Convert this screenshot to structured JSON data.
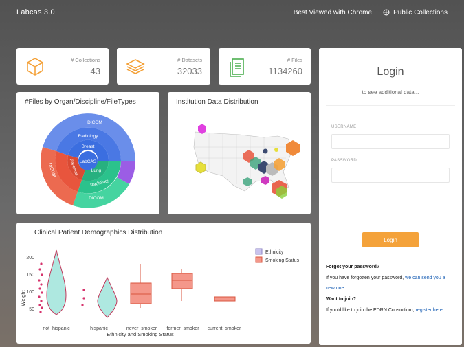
{
  "app": {
    "title": "Labcas 3.0",
    "browser_note": "Best Viewed with Chrome",
    "public_link": "Public Collections"
  },
  "stats": [
    {
      "label": "# Collections",
      "value": "43"
    },
    {
      "label": "# Datasets",
      "value": "32033"
    },
    {
      "label": "# Files",
      "value": "1134260"
    }
  ],
  "sunburst": {
    "title": "#Files by Organ/Discipline/FileTypes",
    "center": "LabCAS",
    "labels": {
      "breast": "Breast",
      "radiology": "Radiology",
      "dicom": "DICOM",
      "lung": "Lung",
      "pancreas": "Pancreas",
      "radiology_lung": "Radiology",
      "dicom_lung": "DICOM"
    },
    "colors": {
      "breast": "#3b6ee0",
      "lung": "#2bc28c",
      "pancreas": "#e8553d",
      "other": "#9b5de5"
    }
  },
  "map": {
    "title": "Institution Data Distribution"
  },
  "demographics": {
    "title": "Clinical Patient Demographics Distribution",
    "ylabel": "Weight",
    "xlabel": "Ethnicity and Smoking Status",
    "legend": [
      {
        "name": "Ethnicity",
        "color": "#aee8e0"
      },
      {
        "name": "Smoking Status",
        "color": "#f4978a"
      }
    ],
    "yticks": [
      "200",
      "150",
      "100",
      "50"
    ],
    "categories": [
      "not_hispanic",
      "hispanic",
      "never_smoker",
      "former_smoker",
      "current_smoker"
    ]
  },
  "login": {
    "title": "Login",
    "subtitle": "to see additional data...",
    "username_label": "USERNAME",
    "password_label": "PASSWORD",
    "button": "Login",
    "forgot_heading": "Forgot your password?",
    "forgot_text": "If you have forgotten your password,",
    "forgot_link": "we can send you a new one.",
    "join_heading": "Want to join?",
    "join_text": "If you'd like to join the EDRN Consortium,",
    "join_link": "register here."
  }
}
